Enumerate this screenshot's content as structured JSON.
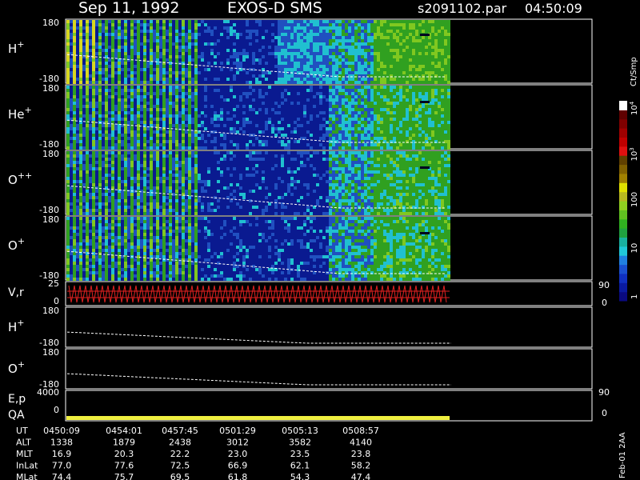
{
  "header": {
    "date": "Sep 11, 1992",
    "instrument": "EXOS-D SMS",
    "file": "s2091102.par",
    "time": "04:50:09"
  },
  "chart_data": {
    "type": "heatmap",
    "panels": [
      {
        "key": "h",
        "species": "H",
        "charge": "+",
        "ylim": [
          -180,
          180
        ],
        "tick_top": "180",
        "tick_bottom": "-180"
      },
      {
        "key": "he",
        "species": "He",
        "charge": "+",
        "ylim": [
          -180,
          180
        ],
        "tick_top": "180",
        "tick_bottom": "-180"
      },
      {
        "key": "opp",
        "species": "O",
        "charge": "++",
        "ylim": [
          -180,
          180
        ],
        "tick_top": "180",
        "tick_bottom": "-180"
      },
      {
        "key": "op",
        "species": "O",
        "charge": "+",
        "ylim": [
          -180,
          180
        ],
        "tick_top": "180",
        "tick_bottom": "-180"
      }
    ],
    "vr_panel": {
      "label": "V,r",
      "left_ticks": [
        "25",
        "0"
      ],
      "right_ticks": [
        "90",
        "0"
      ],
      "color": "#e02020"
    },
    "line_panels": [
      {
        "key": "h_line",
        "species": "H",
        "charge": "+",
        "tick_top": "180",
        "tick_bottom": "-180"
      },
      {
        "key": "o_line",
        "species": "O",
        "charge": "+",
        "tick_top": "180",
        "tick_bottom": "-180"
      }
    ],
    "ep_panel": {
      "label1": "E,p",
      "label2": "QA",
      "left_ticks": [
        "4000",
        "0"
      ],
      "right_ticks": [
        "90",
        "0"
      ],
      "qa_color": "#f0f040"
    },
    "colorbar": {
      "label": "Ct/Smp",
      "ticks": [
        {
          "value": 1,
          "label": "1"
        },
        {
          "value": 10,
          "label": "10"
        },
        {
          "value": 100,
          "label": "100"
        },
        {
          "value": 1000,
          "label": "10",
          "sup": "3"
        },
        {
          "value": 10000,
          "label": "10",
          "sup": "4"
        }
      ],
      "colors": [
        "#0a0a80",
        "#0a1aa0",
        "#1030c0",
        "#1a50d0",
        "#2080e0",
        "#20c8d8",
        "#18b0a0",
        "#20a040",
        "#30b020",
        "#60c020",
        "#90d020",
        "#b8b820",
        "#e0e000",
        "#a08000",
        "#806000",
        "#604000",
        "#e01010",
        "#c00000",
        "#a00000",
        "#800000",
        "#600000",
        "#ffffff"
      ]
    },
    "pattern_description_levels": {
      "low": "#0a1a90",
      "midlow": "#2050c0",
      "cyan": "#20c0d0",
      "green": "#30a020",
      "lightgreen": "#80c820",
      "yellow": "#d8d820"
    },
    "orbit_table": {
      "rows": [
        {
          "label": "UT",
          "values": [
            "0450:09",
            "0454:01",
            "0457:45",
            "0501:29",
            "0505:13",
            "0508:57"
          ]
        },
        {
          "label": "ALT",
          "values": [
            "1338",
            "1879",
            "2438",
            "3012",
            "3582",
            "4140"
          ]
        },
        {
          "label": "MLT",
          "values": [
            "16.9",
            "20.3",
            "22.2",
            "23.0",
            "23.5",
            "23.8"
          ]
        },
        {
          "label": "InLat",
          "values": [
            "77.0",
            "77.6",
            "72.5",
            "66.9",
            "62.1",
            "58.2"
          ]
        },
        {
          "label": "MLat",
          "values": [
            "74.4",
            "75.7",
            "69.5",
            "61.8",
            "54.3",
            "47.4"
          ]
        }
      ]
    },
    "footer_stamp": "Feb-01 2AA"
  }
}
